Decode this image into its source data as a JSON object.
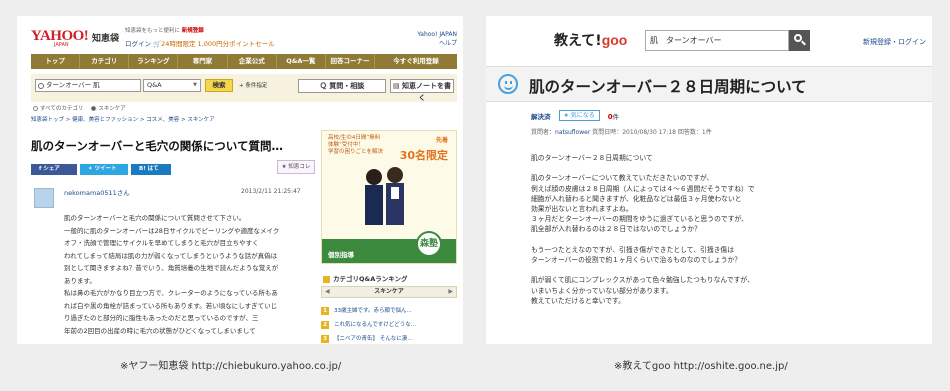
{
  "yahoo": {
    "logo": "YAHOO!",
    "logo_sub": "JAPAN",
    "brand": "知恵袋",
    "promo_line": "知恵袋をもっと便利に",
    "promo_highlight": "新規登録",
    "login": "ログイン",
    "points": "24時間限定 1,000円分ポイントセール",
    "right_link_1": "Yahoo! JAPAN",
    "right_link_2": "ヘルプ",
    "nav": [
      "トップ",
      "カテゴリ",
      "ランキング",
      "専門家",
      "企業公式",
      "Q&A一覧",
      "回答コーナー",
      "今すぐ利用登録"
    ],
    "search_value": "ターンオーバー 肌",
    "search_scope": "Q&A",
    "search_button": "検索",
    "conditions": "+ 条件指定",
    "ask_button": "質問・相談",
    "note_button": "知恵ノートを書く",
    "radio_all": "すべてのカテゴリ",
    "radio_skincare": "スキンケア",
    "breadcrumb": "知恵袋トップ > 健康、美容とファッション > コスメ、美容 > スキンケア",
    "title": "肌のターンオーバーと毛穴の関係について質問…",
    "share_fb": "シェア",
    "share_tw": "ツイート",
    "share_hb": "はてブ",
    "chie_koro": "知恵コレ",
    "username": "nekomama0511さん",
    "date": "2013/2/11 21:25:47",
    "body": [
      "肌のターンオーバーと毛穴の関係について質問させて下さい。",
      "一般的に肌のターンオーバーは28日サイクルでピーリングや適度なメイク",
      "オフ・洗顔で管理にサイクルを早めてしまうと毛穴が目立ちやすく",
      "われてしまって結局は肌の力が弱くなってしまうというような話が真偽は",
      "別として聞きますよね？昔でいう、角質培養の生地で読んだような覚えが",
      "あります。",
      "私は鼻の毛穴がかなり目立つ方で、クレーターのようになっている所もあ",
      "れば白や黒の角栓が詰まっている所もあります。若い頃なにしすぎていじ",
      "り過ぎたのと部分的に脂性もあったのだと思っているのですが、三",
      "年前の2回目の出産の時に毛穴の状態がひどくなってしまいまして"
    ],
    "ad_text_1": "高校/生の4日間”無料",
    "ad_text_2": "体験”受付中！",
    "ad_text_3": "学習の困りごとを解決",
    "ad_tag": "先着",
    "ad_limit": "30名限定",
    "ad_bar": "個別指導",
    "ad_logo": "森塾",
    "rank_title": "カテゴリQ&Aランキング",
    "rank_tab": "スキンケア",
    "ranking": [
      {
        "num": "1",
        "text": "33歳主婦です。赤ら顔で悩ん..."
      },
      {
        "num": "2",
        "text": "これ気になるんですけどどうな..."
      },
      {
        "num": "3",
        "text": "【ニベアの青缶】 そんなに凄..."
      }
    ]
  },
  "goo": {
    "logo_prefix": "教えて!",
    "logo_goo": "goo",
    "search_value": "肌　ターンオーバー",
    "links": "新規登録・ログイン",
    "title": "肌のターンオーバー２８日周期について",
    "resolved": "解決済",
    "fav_button": "★ 気になる",
    "fav_count": "0",
    "fav_unit": "件",
    "meta_prefix": "質問者：",
    "meta_user": "natsuflower",
    "meta_rest": "  質問日時：2010/08/30 17:18  回答数：1件",
    "paragraphs": [
      [
        "肌のターンオーバー２８日周期について"
      ],
      [
        "肌のターンオーバーについて教えていただきたいのですが、",
        "例えば顔の皮膚は２８日周期（人によっては４～６週間だそうですね）で",
        "細胞が入れ替わると聞きますが、化粧品などは最低３ヶ月使わないと",
        "効果が出ないと言われますよね。",
        "３ヶ月だとターンオーバーの期間をゆうに過ぎていると思うのですが、",
        "肌全部が入れ替わるのは２８日ではないのでしょうか？"
      ],
      [
        "もう一つたとえなのですが、引掻き傷ができたとして、引掻き傷は",
        "ターンオーバーの役割で約１ヶ月くらいで治るものなのでしょうか？"
      ],
      [
        "肌が弱くて肌にコンプレックスがあって色々勉強したつもりなんですが、",
        "いまいちよく分かっていない部分があります。",
        "教えていただけると幸いです。"
      ]
    ]
  },
  "captions": {
    "left": "※ヤフー知恵袋  http://chiebukuro.yahoo.co.jp/",
    "right": "※教えてgoo  http://oshite.goo.ne.jp/"
  },
  "colors": {
    "yahoo_nav": "#8f7b35",
    "yahoo_red": "#d11f27",
    "goo_red": "#d8392c",
    "goo_accent": "#4aa0d8",
    "link": "#1a4b8c"
  }
}
